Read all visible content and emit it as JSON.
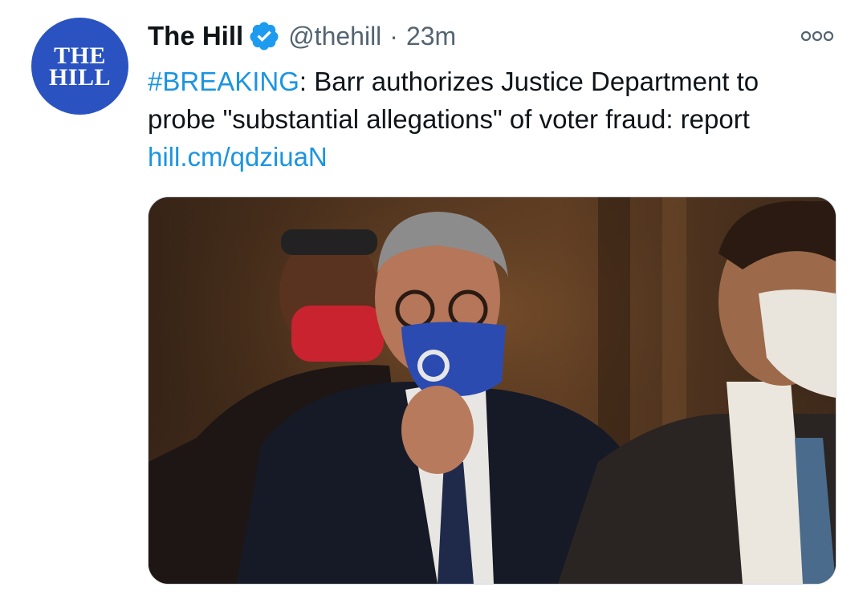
{
  "tweet": {
    "avatar_text_line1": "THE",
    "avatar_text_line2": "HILL",
    "display_name": "The Hill",
    "verified": true,
    "handle": "@thehill",
    "separator": "·",
    "timestamp": "23m",
    "hashtag": "#BREAKING",
    "text_line1_rest": ": Barr authorizes Justice Department to",
    "text_line2": "probe \"substantial allegations\" of voter fraud: report",
    "link": "hill.cm/qdziuaN"
  },
  "icons": {
    "verified": "verified-badge-icon",
    "more": "more-options-icon"
  },
  "colors": {
    "avatar_bg": "#2a53c1",
    "link": "#1b95e0",
    "verified": "#1d9bf0",
    "secondary_text": "#536471"
  }
}
